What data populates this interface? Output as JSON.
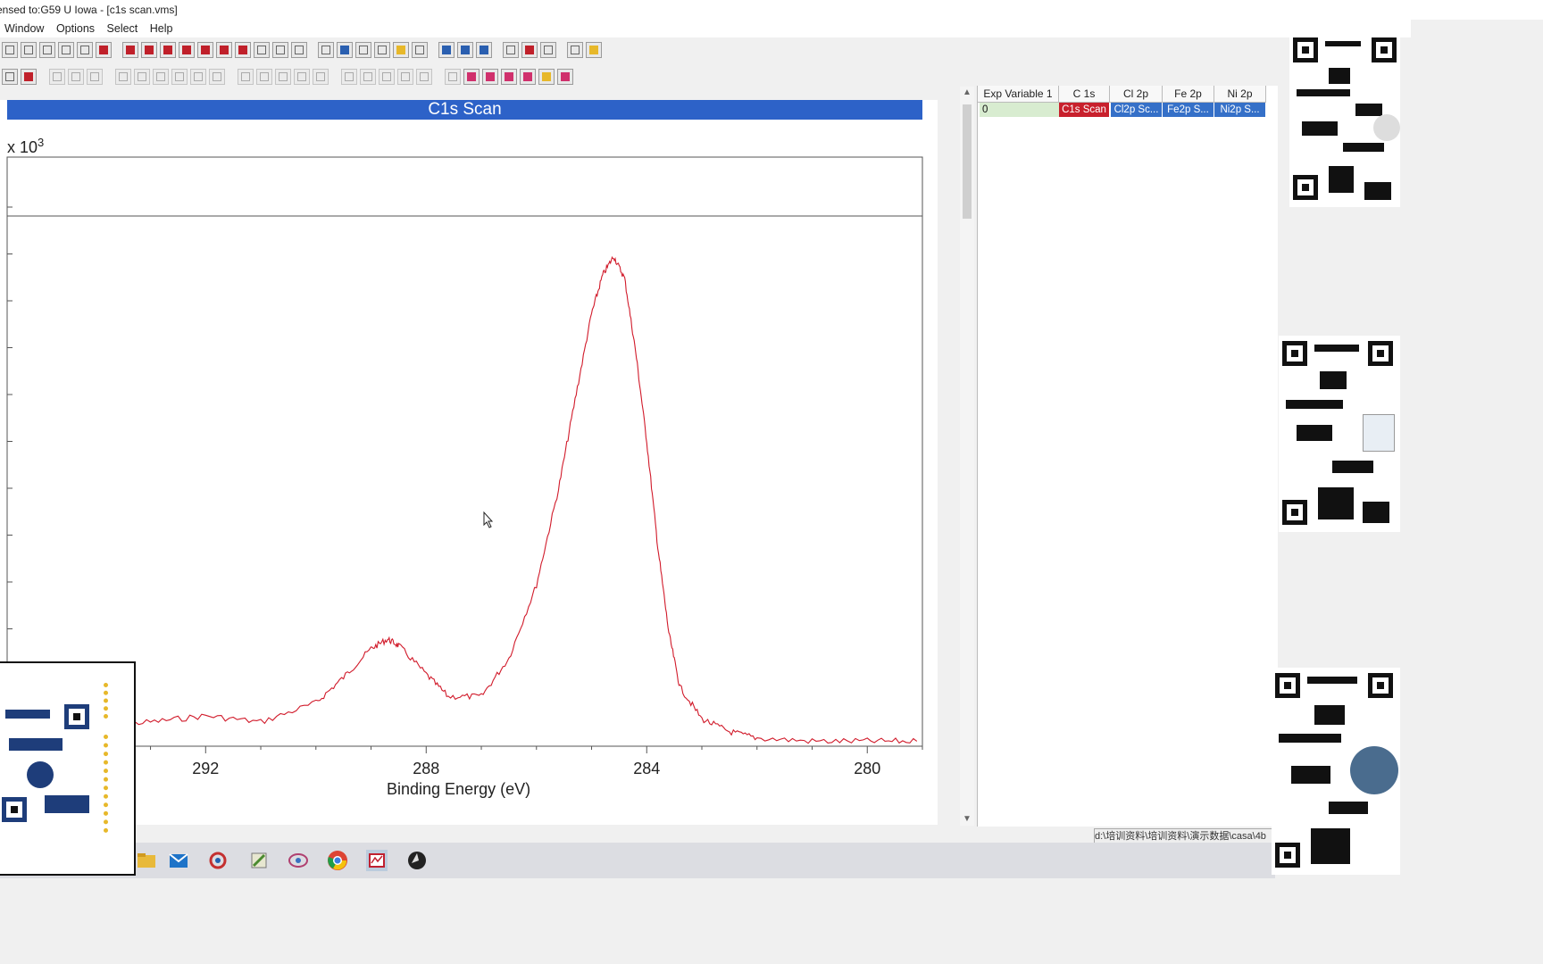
{
  "window": {
    "title": "ensed to:G59 U Iowa - [c1s scan.vms]"
  },
  "menu": {
    "items": [
      "Window",
      "Options",
      "Select",
      "Help"
    ]
  },
  "plot": {
    "title": "C1s Scan",
    "scale_label": "x 10",
    "scale_exponent": "3",
    "xlabel": "Binding Energy (eV)",
    "line_color": "#d11a2a",
    "title_bar_color": "#2d62c8"
  },
  "browser": {
    "headers": [
      "Exp Variable 1",
      "C 1s",
      "Cl 2p",
      "Fe 2p",
      "Ni 2p"
    ],
    "row": {
      "exp_variable": "0",
      "cells": [
        "C1s Scan",
        "Cl2p Sc...",
        "Fe2p S...",
        "Ni2p S..."
      ]
    }
  },
  "status": {
    "path": "d:\\培训资料\\培训资料\\演示数据\\casa\\4b"
  },
  "chart_data": {
    "type": "line",
    "title": "C1s Scan",
    "xlabel": "Binding Energy (eV)",
    "ylabel": "",
    "y_multiplier": "x 10^3",
    "xlim": [
      295.6,
      279.0
    ],
    "x_reversed": true,
    "xticks": [
      292,
      288,
      284,
      280
    ],
    "grid": false,
    "series": [
      {
        "x": [
          294.0,
          293.0,
          292.0,
          291.0,
          290.0,
          289.5,
          289.0,
          288.7,
          288.5,
          288.0,
          287.6,
          287.0,
          286.5,
          286.0,
          285.6,
          285.3,
          285.0,
          284.8,
          284.6,
          284.4,
          284.2,
          284.0,
          283.8,
          283.6,
          283.4,
          283.0,
          282.5,
          282.0,
          281.0,
          280.0,
          279.1
        ],
        "y": [
          0.06,
          0.07,
          0.09,
          0.07,
          0.13,
          0.21,
          0.3,
          0.33,
          0.31,
          0.22,
          0.15,
          0.15,
          0.27,
          0.5,
          0.8,
          1.08,
          1.35,
          1.47,
          1.53,
          1.46,
          1.23,
          0.95,
          0.62,
          0.35,
          0.18,
          0.08,
          0.04,
          0.02,
          0.01,
          0.01,
          0.01
        ]
      }
    ]
  }
}
